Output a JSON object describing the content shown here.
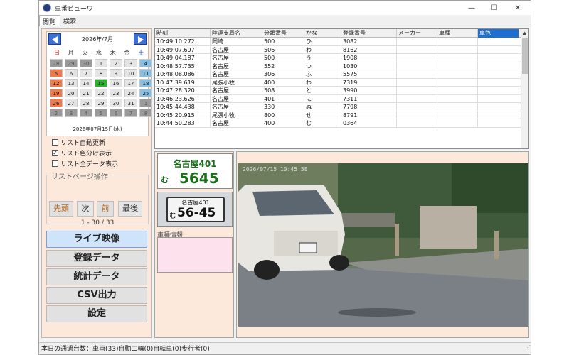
{
  "window": {
    "title": "車番ビューワ",
    "minimize": "—",
    "maximize": "☐",
    "close": "✕"
  },
  "tabs": [
    {
      "label": "閲覧"
    },
    {
      "label": "検索"
    }
  ],
  "calendar": {
    "month": "2026年/7月",
    "weekdays": [
      "日",
      "月",
      "火",
      "水",
      "木",
      "金",
      "土"
    ],
    "days": [
      "28",
      "29",
      "30",
      "1",
      "2",
      "3",
      "4",
      "5",
      "6",
      "7",
      "8",
      "9",
      "10",
      "11",
      "12",
      "13",
      "14",
      "15",
      "16",
      "17",
      "18",
      "19",
      "20",
      "21",
      "22",
      "23",
      "24",
      "25",
      "26",
      "27",
      "28",
      "29",
      "30",
      "31",
      "1",
      "2",
      "3",
      "4",
      "5",
      "6",
      "7",
      "8"
    ],
    "selected_date": "2026年07月15日(水)"
  },
  "checkboxes": [
    {
      "label": "リスト自動更新",
      "checked": false
    },
    {
      "label": "リスト色分け表示",
      "checked": true
    },
    {
      "label": "リスト全データ表示",
      "checked": false
    }
  ],
  "paging": {
    "title": "リストページ操作",
    "first": "先頭",
    "next": "次",
    "prev": "前",
    "last": "最後",
    "info": "1 - 30 / 33"
  },
  "menu": {
    "live": "ライブ映像",
    "registered": "登録データ",
    "stats": "統計データ",
    "csv": "CSV出力",
    "settings": "設定"
  },
  "table": {
    "columns": [
      "時刻",
      "陸運支局名",
      "分類番号",
      "かな",
      "登録番号",
      "メーカー",
      "車種",
      "車色"
    ],
    "rows": [
      [
        "10:49:10.272",
        "岡崎",
        "500",
        "ひ",
        "3082",
        "",
        "",
        ""
      ],
      [
        "10:49:07.697",
        "名古屋",
        "506",
        "わ",
        "8162",
        "",
        "",
        ""
      ],
      [
        "10:49:04.187",
        "名古屋",
        "500",
        "う",
        "1908",
        "",
        "",
        ""
      ],
      [
        "10:48:57.735",
        "名古屋",
        "552",
        "つ",
        "1030",
        "",
        "",
        ""
      ],
      [
        "10:48:08.086",
        "名古屋",
        "306",
        "ふ",
        "5575",
        "",
        "",
        ""
      ],
      [
        "10:47:39.619",
        "尾張小牧",
        "400",
        "わ",
        "7319",
        "",
        "",
        ""
      ],
      [
        "10:47:28.320",
        "名古屋",
        "508",
        "と",
        "3990",
        "",
        "",
        ""
      ],
      [
        "10:46:23.626",
        "名古屋",
        "401",
        "に",
        "7311",
        "",
        "",
        ""
      ],
      [
        "10:45:44.438",
        "名古屋",
        "330",
        "ぬ",
        "7798",
        "",
        "",
        ""
      ],
      [
        "10:45:20.915",
        "尾張小牧",
        "800",
        "せ",
        "8791",
        "",
        "",
        ""
      ],
      [
        "10:44:50.283",
        "名古屋",
        "400",
        "む",
        "0364",
        "",
        "",
        ""
      ]
    ]
  },
  "plate": {
    "region_class": "名古屋401",
    "kana": "む",
    "number": "5645",
    "photo_top": "名古屋401",
    "photo_kana": "む",
    "photo_number": "56-45"
  },
  "vehicle_info": {
    "label": "車種情報"
  },
  "video": {
    "timestamp": "2026/07/15 10:45:58"
  },
  "status": {
    "text": "本日の通過台数：車両(33)自動二輪(0)自転車(0)歩行者(0)"
  }
}
